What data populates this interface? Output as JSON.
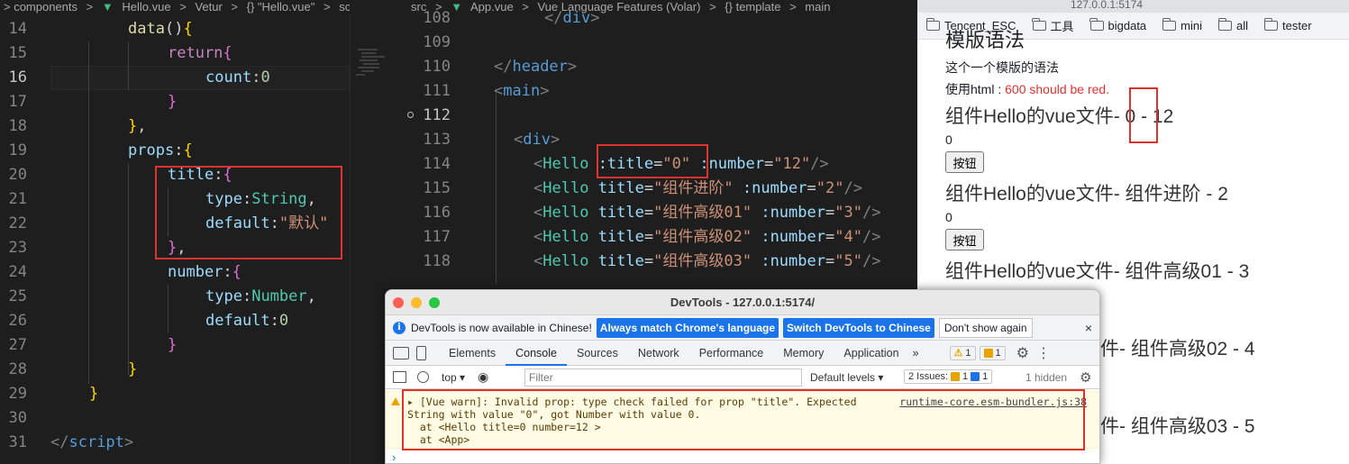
{
  "left_editor": {
    "breadcrumb": [
      "> components",
      ">",
      "Hello.vue",
      ">",
      "Vetur",
      ">",
      "{} \"Hello.vue\"",
      ">",
      "script",
      ">"
    ],
    "lines": [
      {
        "n": "14",
        "tokens": [
          [
            "k-yel",
            "data"
          ],
          [
            "k-wht",
            "()"
          ],
          [
            "brace-y",
            "{"
          ]
        ]
      },
      {
        "n": "15",
        "tokens": [
          [
            "k-pur",
            "return"
          ],
          [
            "brace-p",
            "{"
          ]
        ]
      },
      {
        "n": "16",
        "tokens": [
          [
            "k-blu",
            "count"
          ],
          [
            "k-wht",
            ":"
          ],
          [
            "k-num",
            "0"
          ]
        ]
      },
      {
        "n": "17",
        "tokens": [
          [
            "brace-p",
            "}"
          ]
        ]
      },
      {
        "n": "18",
        "tokens": [
          [
            "brace-y",
            "}"
          ],
          [
            "k-wht",
            ","
          ]
        ]
      },
      {
        "n": "19",
        "tokens": [
          [
            "k-blu",
            "props"
          ],
          [
            "k-wht",
            ":"
          ],
          [
            "brace-y",
            "{"
          ]
        ]
      },
      {
        "n": "20",
        "tokens": [
          [
            "k-blu",
            "title"
          ],
          [
            "k-wht",
            ":"
          ],
          [
            "brace-p",
            "{"
          ]
        ]
      },
      {
        "n": "21",
        "tokens": [
          [
            "k-blu",
            "type"
          ],
          [
            "k-wht",
            ":"
          ],
          [
            "k-grn",
            "String"
          ],
          [
            "k-wht",
            ","
          ]
        ]
      },
      {
        "n": "22",
        "tokens": [
          [
            "k-blu",
            "default"
          ],
          [
            "k-wht",
            ":"
          ],
          [
            "k-str",
            "\"默认\""
          ]
        ]
      },
      {
        "n": "23",
        "tokens": [
          [
            "brace-p",
            "}"
          ],
          [
            "k-wht",
            ","
          ]
        ]
      },
      {
        "n": "24",
        "tokens": [
          [
            "k-blu",
            "number"
          ],
          [
            "k-wht",
            ":"
          ],
          [
            "brace-p",
            "{"
          ]
        ]
      },
      {
        "n": "25",
        "tokens": [
          [
            "k-blu",
            "type"
          ],
          [
            "k-wht",
            ":"
          ],
          [
            "k-grn",
            "Number"
          ],
          [
            "k-wht",
            ","
          ]
        ]
      },
      {
        "n": "26",
        "tokens": [
          [
            "k-blu",
            "default"
          ],
          [
            "k-wht",
            ":"
          ],
          [
            "k-num",
            "0"
          ]
        ]
      },
      {
        "n": "27",
        "tokens": [
          [
            "brace-p",
            "}"
          ]
        ]
      },
      {
        "n": "28",
        "tokens": [
          [
            "brace-y",
            "}"
          ]
        ]
      },
      {
        "n": "29",
        "tokens": [
          [
            "brace-y",
            "}"
          ]
        ]
      },
      {
        "n": "30",
        "tokens": []
      },
      {
        "n": "31",
        "tokens": [
          [
            "k-tagb",
            "</"
          ],
          [
            "k-tag",
            "script"
          ],
          [
            "k-tagb",
            ">"
          ]
        ]
      }
    ]
  },
  "mid_editor": {
    "breadcrumb": [
      "src",
      ">",
      "App.vue",
      ">",
      "Vue Language Features (Volar)",
      ">",
      "{} template",
      ">",
      "main"
    ],
    "lines": [
      {
        "n": "108",
        "tokens": [
          [
            "k-tagb",
            "</"
          ],
          [
            "k-tag",
            "div"
          ],
          [
            "k-tagb",
            ">"
          ]
        ]
      },
      {
        "n": "109",
        "tokens": []
      },
      {
        "n": "110",
        "tokens": [
          [
            "k-tagb",
            "</"
          ],
          [
            "k-tag",
            "header"
          ],
          [
            "k-tagb",
            ">"
          ]
        ]
      },
      {
        "n": "111",
        "tokens": [
          [
            "k-tagb",
            "<"
          ],
          [
            "k-tag",
            "main"
          ],
          [
            "k-tagb",
            ">"
          ]
        ]
      },
      {
        "n": "112",
        "tokens": []
      },
      {
        "n": "113",
        "tokens": [
          [
            "k-tagb",
            "<"
          ],
          [
            "k-tag",
            "div"
          ],
          [
            "k-tagb",
            ">"
          ]
        ]
      },
      {
        "n": "114",
        "tokens": [
          [
            "k-tagb",
            "<"
          ],
          [
            "k-grn",
            "Hello"
          ],
          [
            "k-wht",
            " "
          ],
          [
            "k-blu",
            ":title"
          ],
          [
            "k-wht",
            "="
          ],
          [
            "k-str",
            "\"0\""
          ],
          [
            "k-wht",
            " "
          ],
          [
            "k-blu",
            ":number"
          ],
          [
            "k-wht",
            "="
          ],
          [
            "k-str",
            "\"12\""
          ],
          [
            "k-tagb",
            "/>"
          ]
        ]
      },
      {
        "n": "115",
        "tokens": [
          [
            "k-tagb",
            "<"
          ],
          [
            "k-grn",
            "Hello"
          ],
          [
            "k-wht",
            " "
          ],
          [
            "k-blu",
            "title"
          ],
          [
            "k-wht",
            "="
          ],
          [
            "k-str",
            "\"组件进阶\""
          ],
          [
            "k-wht",
            " "
          ],
          [
            "k-blu",
            ":number"
          ],
          [
            "k-wht",
            "="
          ],
          [
            "k-str",
            "\"2\""
          ],
          [
            "k-tagb",
            "/>"
          ]
        ]
      },
      {
        "n": "116",
        "tokens": [
          [
            "k-tagb",
            "<"
          ],
          [
            "k-grn",
            "Hello"
          ],
          [
            "k-wht",
            " "
          ],
          [
            "k-blu",
            "title"
          ],
          [
            "k-wht",
            "="
          ],
          [
            "k-str",
            "\"组件高级01\""
          ],
          [
            "k-wht",
            " "
          ],
          [
            "k-blu",
            ":number"
          ],
          [
            "k-wht",
            "="
          ],
          [
            "k-str",
            "\"3\""
          ],
          [
            "k-tagb",
            "/>"
          ]
        ]
      },
      {
        "n": "117",
        "tokens": [
          [
            "k-tagb",
            "<"
          ],
          [
            "k-grn",
            "Hello"
          ],
          [
            "k-wht",
            " "
          ],
          [
            "k-blu",
            "title"
          ],
          [
            "k-wht",
            "="
          ],
          [
            "k-str",
            "\"组件高级02\""
          ],
          [
            "k-wht",
            " "
          ],
          [
            "k-blu",
            ":number"
          ],
          [
            "k-wht",
            "="
          ],
          [
            "k-str",
            "\"4\""
          ],
          [
            "k-tagb",
            "/>"
          ]
        ]
      },
      {
        "n": "118",
        "tokens": [
          [
            "k-tagb",
            "<"
          ],
          [
            "k-grn",
            "Hello"
          ],
          [
            "k-wht",
            " "
          ],
          [
            "k-blu",
            "title"
          ],
          [
            "k-wht",
            "="
          ],
          [
            "k-str",
            "\"组件高级03\""
          ],
          [
            "k-wht",
            " "
          ],
          [
            "k-blu",
            ":number"
          ],
          [
            "k-wht",
            "="
          ],
          [
            "k-str",
            "\"5\""
          ],
          [
            "k-tagb",
            "/>"
          ]
        ]
      }
    ]
  },
  "browser": {
    "url": "127.0.0.1:5174",
    "bookmarks": [
      "Tencent_ESC",
      "工具",
      "bigdata",
      "mini",
      "all",
      "tester"
    ],
    "page": {
      "cut_title": "模版语法",
      "line1": "这个一个模版的语法",
      "line2_prefix": "使用html : ",
      "line2_red": "600 should be red.",
      "blocks": [
        {
          "heading_prefix": "组件Hello的vue文件- ",
          "title": "0",
          "sep": " - ",
          "number": "12",
          "count": "0",
          "button": "按钮"
        },
        {
          "heading_prefix": "组件Hello的vue文件- ",
          "title": "组件进阶",
          "sep": " - ",
          "number": "2",
          "count": "0",
          "button": "按钮"
        },
        {
          "heading_prefix": "组件Hello的vue文件- ",
          "title": "组件高级01",
          "sep": " - ",
          "number": "3"
        },
        {
          "heading_tail": "件- 组件高级02 - 4"
        },
        {
          "heading_tail": "件- 组件高级03 - 5"
        }
      ]
    }
  },
  "devtools": {
    "title": "DevTools - 127.0.0.1:5174/",
    "notice": {
      "text": "DevTools is now available in Chinese!",
      "btn_match": "Always match Chrome's language",
      "btn_switch": "Switch DevTools to Chinese",
      "btn_dismiss": "Don't show again",
      "close": "×"
    },
    "tabs": [
      "Elements",
      "Console",
      "Sources",
      "Network",
      "Performance",
      "Memory",
      "Application",
      "»"
    ],
    "tab_warn_count": "1",
    "tab_issue_count": "1",
    "toolbar": {
      "context": "top ▾",
      "filter_placeholder": "Filter",
      "levels": "Default levels ▾",
      "issues_label": "2 Issues:",
      "issues_warn": "1",
      "issues_info": "1",
      "hidden": "1 hidden"
    },
    "message": {
      "line1": "▸ [Vue warn]: Invalid prop: type check failed for prop \"title\". Expected",
      "line2": "String with value \"0\", got Number with value 0.",
      "line3": "  at <Hello title=0 number=12 >",
      "line4": "  at <App>",
      "source": "runtime-core.esm-bundler.js:38"
    },
    "prompt": "›"
  }
}
